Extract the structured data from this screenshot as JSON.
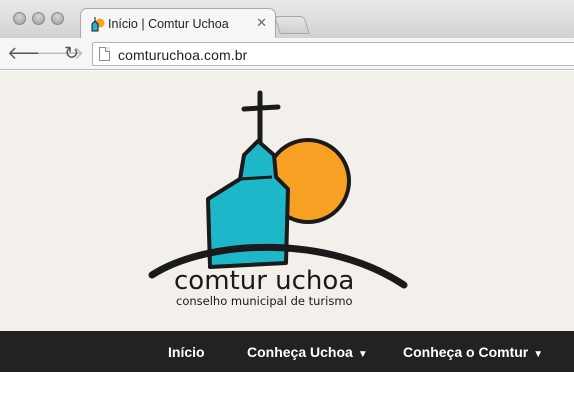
{
  "browser": {
    "tab_title": "Início | Comtur Uchoa",
    "tab_close": "✕",
    "url": "comturuchoa.com.br",
    "back_icon": "🡐",
    "forward_icon": "🡒",
    "reload_icon": "↻"
  },
  "header": {
    "logo_title": "comtur uchoa",
    "logo_subtitle": "conselho municipal de turismo",
    "colors": {
      "background": "#f3f0eb",
      "church": "#1db7c9",
      "sun": "#f8a024",
      "outline": "#1a1a1a"
    }
  },
  "nav": {
    "items": [
      {
        "label": "Início",
        "caret": ""
      },
      {
        "label": "Conheça Uchoa",
        "caret": "▼"
      },
      {
        "label": "Conheça o Comtur",
        "caret": "▼"
      }
    ],
    "background": "#222220",
    "text_color": "#ffffff"
  }
}
